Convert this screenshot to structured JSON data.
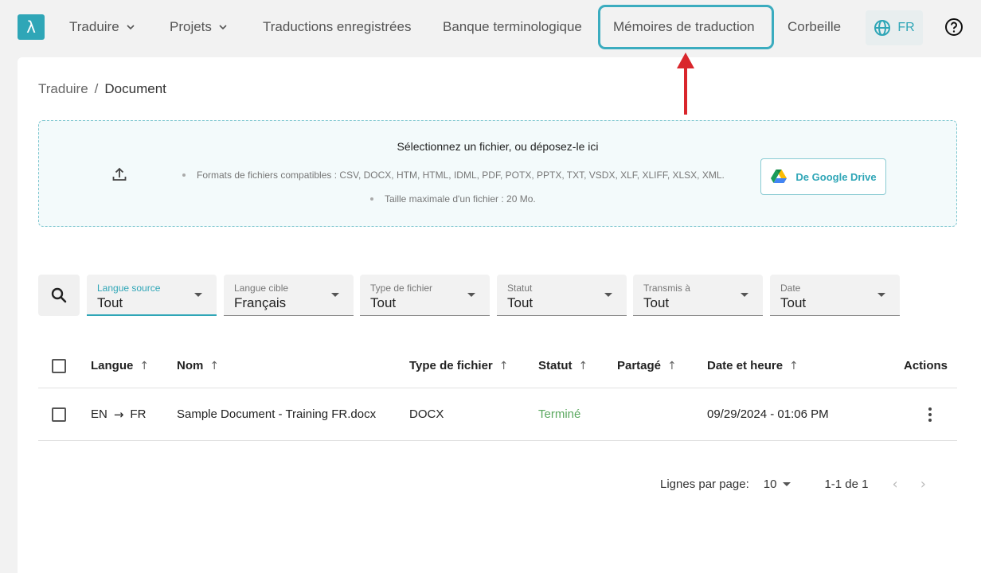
{
  "nav": {
    "logo_glyph": "λ",
    "items": [
      {
        "label": "Traduire",
        "has_dropdown": true
      },
      {
        "label": "Projets",
        "has_dropdown": true
      },
      {
        "label": "Traductions enregistrées",
        "has_dropdown": false
      },
      {
        "label": "Banque terminologique",
        "has_dropdown": false
      },
      {
        "label": "Mémoires de traduction",
        "has_dropdown": false,
        "highlighted": true
      },
      {
        "label": "Corbeille",
        "has_dropdown": false
      }
    ],
    "language": "FR",
    "language_icon": "globe-icon",
    "help_icon": "help-circle-icon"
  },
  "breadcrumb": {
    "parent": "Traduire",
    "separator": "/",
    "current": "Document"
  },
  "upload": {
    "title": "Sélectionnez un fichier, ou déposez-le ici",
    "formats": "Formats de fichiers compatibles : CSV, DOCX, HTM, HTML, IDML, PDF, POTX, PPTX, TXT, VSDX, XLF, XLIFF, XLSX, XML.",
    "max_size": "Taille maximale d'un fichier : 20 Mo.",
    "gdrive_label": "De Google Drive",
    "upload_icon": "upload-icon"
  },
  "filters": [
    {
      "label": "Langue source",
      "value": "Tout",
      "active": true
    },
    {
      "label": "Langue cible",
      "value": "Français",
      "active": false
    },
    {
      "label": "Type de fichier",
      "value": "Tout",
      "active": false
    },
    {
      "label": "Statut",
      "value": "Tout",
      "active": false
    },
    {
      "label": "Transmis à",
      "value": "Tout",
      "active": false
    },
    {
      "label": "Date",
      "value": "Tout",
      "active": false
    }
  ],
  "table": {
    "headers": {
      "language": "Langue",
      "name": "Nom",
      "filetype": "Type de fichier",
      "status": "Statut",
      "shared": "Partagé",
      "datetime": "Date et heure",
      "actions": "Actions"
    },
    "sort_glyph": "↑",
    "rows": [
      {
        "source_lang": "EN",
        "arrow": "→",
        "target_lang": "FR",
        "name": "Sample Document - Training FR.docx",
        "filetype": "DOCX",
        "status": "Terminé",
        "shared": "",
        "datetime": "09/29/2024 - 01:06 PM"
      }
    ]
  },
  "pagination": {
    "rows_label": "Lignes par page:",
    "rows_value": "10",
    "range": "1-1 de 1",
    "prev": "‹",
    "next": "›"
  },
  "colors": {
    "accent": "#2fa6b7",
    "status_done": "#5aa85f",
    "annotation_arrow": "#d9262c"
  }
}
